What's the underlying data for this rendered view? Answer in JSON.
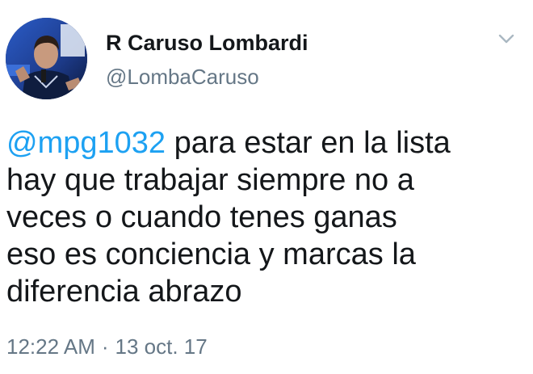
{
  "author": {
    "display_name": "R Caruso Lombardi",
    "handle": "@LombaCaruso",
    "avatar_icon": "profile-photo"
  },
  "menu": {
    "icon": "chevron-down-icon"
  },
  "tweet": {
    "mention": "@mpg1032",
    "lines": [
      " para estar en la lista",
      "hay que trabajar siempre no a",
      "veces o cuando tenes ganas",
      "eso es conciencia y marcas la",
      "diferencia abrazo"
    ]
  },
  "meta": {
    "time": "12:22 AM",
    "separator": "·",
    "date": "13 oct. 17"
  },
  "colors": {
    "link": "#1da1f2",
    "secondary_text": "#657786",
    "primary_text": "#14171a"
  }
}
